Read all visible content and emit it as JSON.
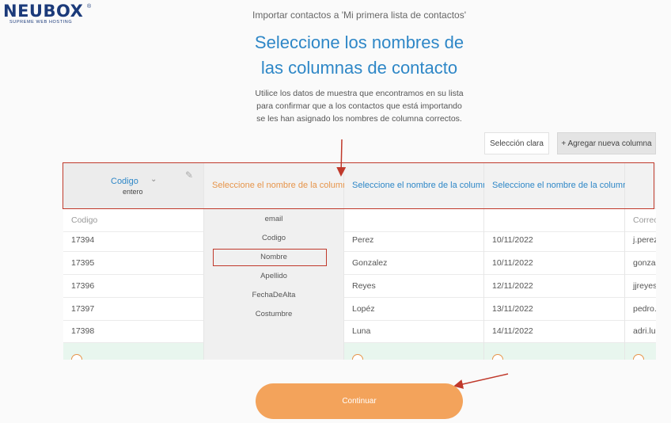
{
  "logo": {
    "text": "NEUBOX",
    "tagline": "SUPREME WEB HOSTING",
    "reg": "®"
  },
  "header": {
    "crumb": "Importar contactos a 'Mi primera lista de contactos'",
    "title_line1": "Seleccione los nombres de",
    "title_line2": "las columnas de contacto",
    "desc_line1": "Utilice los datos de muestra que encontramos en su lista",
    "desc_line2": "para confirmar que a los contactos que está importando",
    "desc_line3": "se les han asignado los nombres de columna correctos."
  },
  "actions": {
    "clear": "Selección clara",
    "add": "+ Agregar nueva columna"
  },
  "columns": {
    "col0": {
      "name": "Codigo",
      "type": "entero",
      "top": "Codigo",
      "rows": [
        "17394",
        "17395",
        "17396",
        "17397",
        "17398"
      ]
    },
    "col1": {
      "select": "Seleccione el nombre de la columna",
      "options": [
        "email",
        "Codigo",
        "Nombre",
        "Apellido",
        "FechaDeAlta",
        "Costumbre"
      ]
    },
    "col2": {
      "select": "Seleccione el nombre de la columna",
      "top": "",
      "rows": [
        "Perez",
        "Gonzalez",
        "Reyes",
        "Lopéz",
        "Luna"
      ]
    },
    "col3": {
      "select": "Seleccione el nombre de la columna",
      "top": "",
      "rows": [
        "10/11/2022",
        "10/11/2022",
        "12/11/2022",
        "13/11/2022",
        "14/11/2022"
      ]
    },
    "col4": {
      "top": "Correo",
      "rows": [
        "j.perez",
        "gonzal",
        "jjreyes",
        "pedro.",
        "adri.lu"
      ]
    }
  },
  "continue_label": "Continuar",
  "colors": {
    "accent_blue": "#2e87c7",
    "accent_orange": "#f3a35b",
    "annotation_red": "#c0392b"
  }
}
